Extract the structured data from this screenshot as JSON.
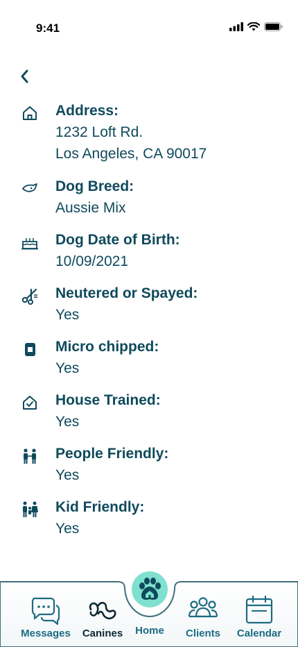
{
  "status": {
    "time": "9:41"
  },
  "fields": [
    {
      "label": "Address:",
      "value1": "1232 Loft Rd.",
      "value2": "Los Angeles, CA 90017",
      "icon": "house-icon"
    },
    {
      "label": "Dog Breed:",
      "value1": "Aussie Mix",
      "icon": "dog-head-icon"
    },
    {
      "label": "Dog Date of Birth:",
      "value1": "10/09/2021",
      "icon": "cake-icon"
    },
    {
      "label": "Neutered or Spayed:",
      "value1": "Yes",
      "icon": "scissors-icon"
    },
    {
      "label": "Micro chipped:",
      "value1": "Yes",
      "icon": "chip-icon"
    },
    {
      "label": "House Trained:",
      "value1": "Yes",
      "icon": "house-check-icon"
    },
    {
      "label": "People Friendly:",
      "value1": "Yes",
      "icon": "people-icon"
    },
    {
      "label": "Kid Friendly:",
      "value1": "Yes",
      "icon": "family-icon"
    }
  ],
  "tabs": [
    {
      "label": "Messages"
    },
    {
      "label": "Canines"
    },
    {
      "label": "Home"
    },
    {
      "label": "Clients"
    },
    {
      "label": "Calendar"
    }
  ],
  "colors": {
    "primary": "#0f4a5c",
    "accent": "#7fe0d0",
    "tab": "#1c6b82"
  }
}
